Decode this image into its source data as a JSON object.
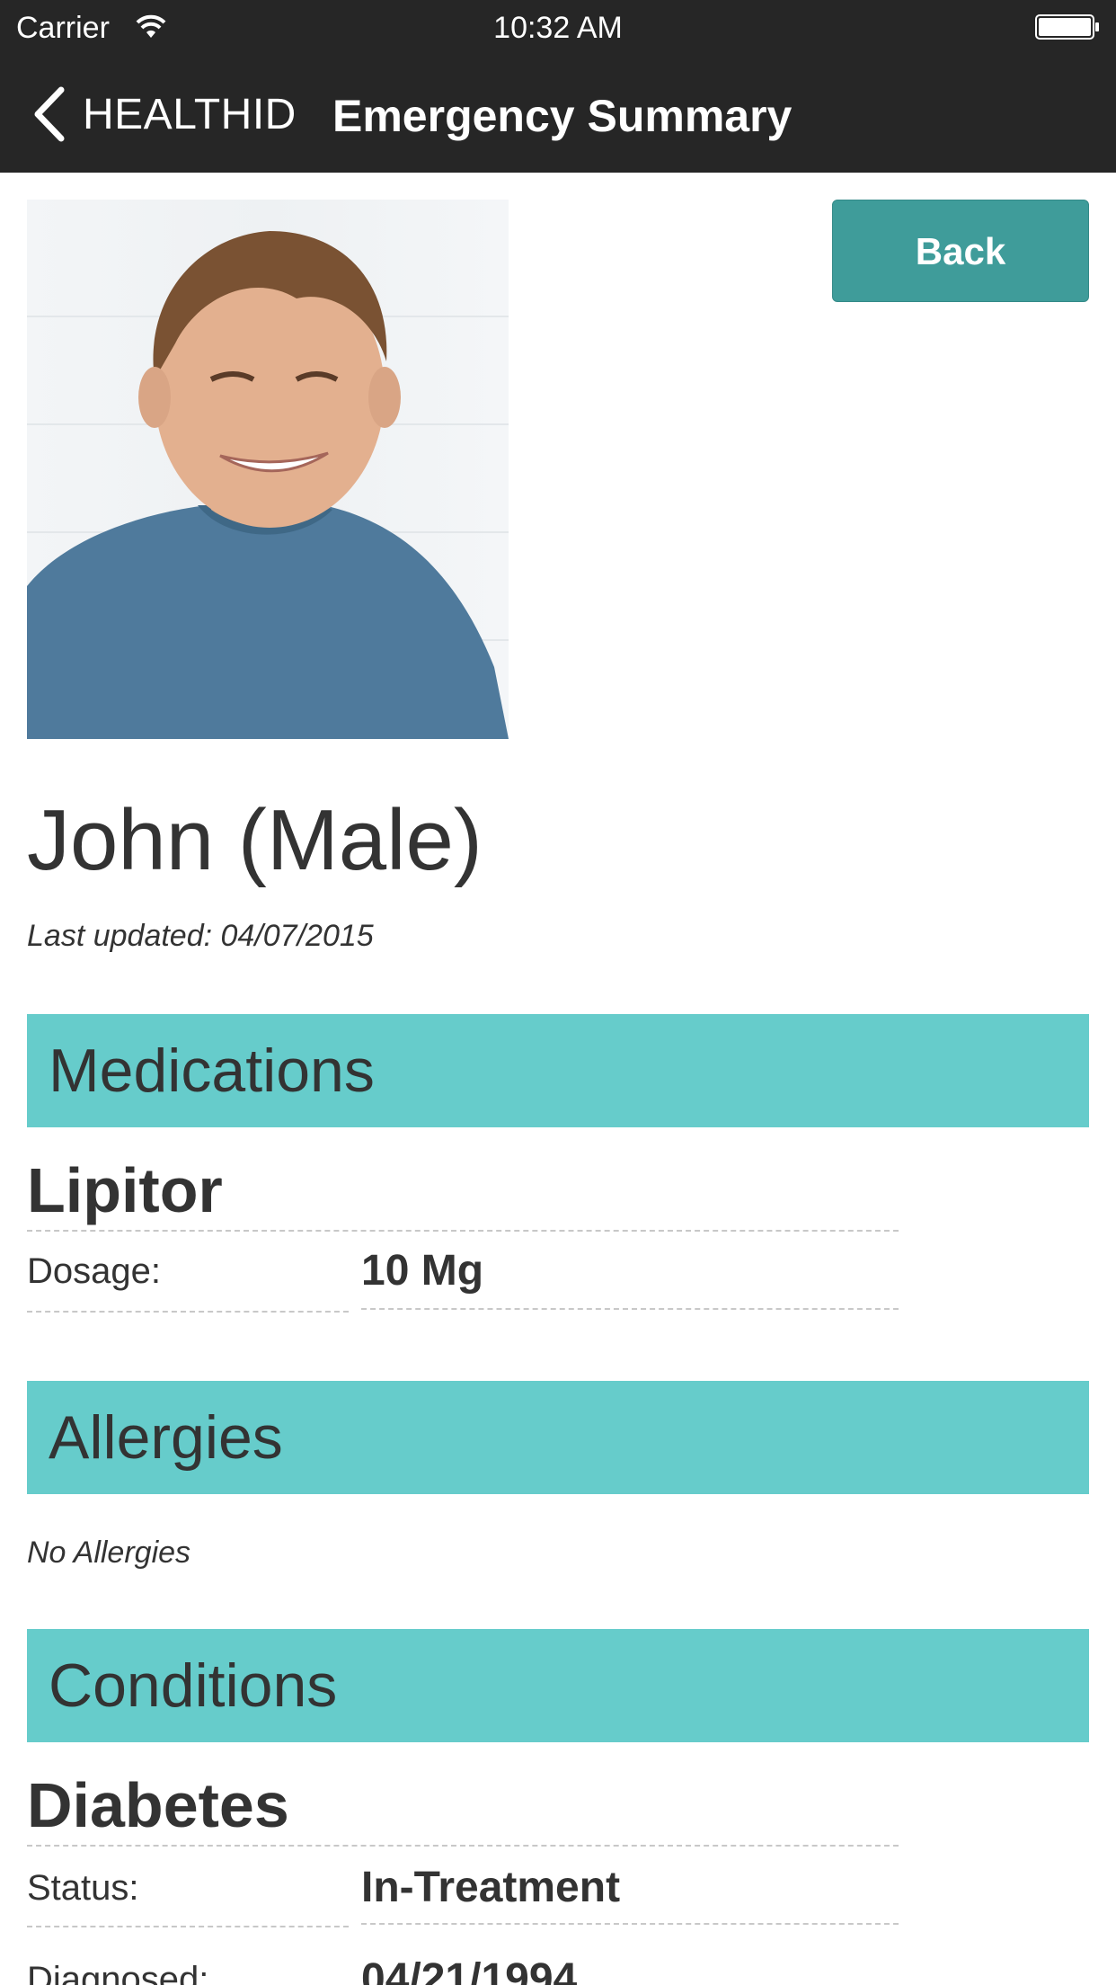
{
  "status_bar": {
    "carrier": "Carrier",
    "time": "10:32 AM"
  },
  "nav": {
    "back_label": "HEALTHID",
    "title": "Emergency Summary"
  },
  "profile": {
    "back_button": "Back",
    "name": "John (Male)",
    "last_updated": "Last updated: 04/07/2015"
  },
  "medications": {
    "header": "Medications",
    "items": [
      {
        "name": "Lipitor",
        "dosage_label": "Dosage:",
        "dosage_value": "10 Mg"
      }
    ]
  },
  "allergies": {
    "header": "Allergies",
    "empty_text": "No Allergies"
  },
  "conditions": {
    "header": "Conditions",
    "items": [
      {
        "name": "Diabetes",
        "status_label": "Status:",
        "status_value": "In-Treatment",
        "diagnosed_label": "Diagnosed:",
        "diagnosed_value": "04/21/1994"
      }
    ]
  },
  "colors": {
    "bar_bg": "#262626",
    "section_header_bg": "#66cccb",
    "button_bg": "#3f9c9a"
  }
}
